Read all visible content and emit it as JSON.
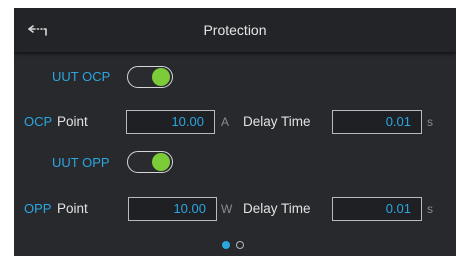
{
  "header": {
    "title": "Protection",
    "back_icon": "back-arrow-icon"
  },
  "ocp": {
    "toggle_label": "UUT OCP",
    "toggle_on": true,
    "point_label_prefix": "OCP",
    "point_label_word": "Point",
    "point_value": "10.00",
    "point_unit": "A",
    "delay_label": "Delay Time",
    "delay_value": "0.01",
    "delay_unit": "s"
  },
  "opp": {
    "toggle_label": "UUT OPP",
    "toggle_on": true,
    "point_label_prefix": "OPP",
    "point_label_word": "Point",
    "point_value": "10.00",
    "point_unit": "W",
    "delay_label": "Delay Time",
    "delay_value": "0.01",
    "delay_unit": "s"
  },
  "pagination": {
    "current_page": 1,
    "total_pages": 2
  },
  "colors": {
    "accent_blue": "#2aa6e0",
    "toggle_green": "#7ccc3a",
    "background": "#28292d"
  }
}
